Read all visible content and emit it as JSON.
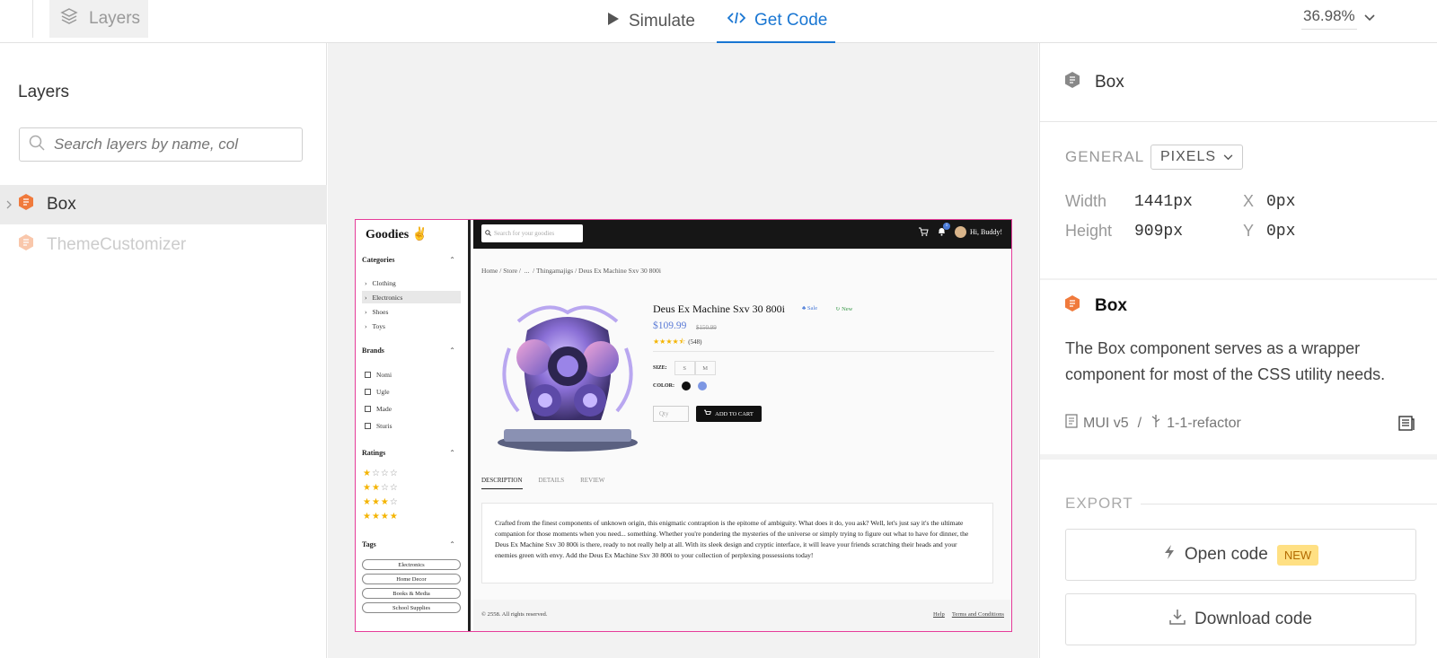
{
  "topbar": {
    "layers_label": "Layers",
    "simulate_label": "Simulate",
    "get_code_label": "Get Code",
    "zoom": "36.98%"
  },
  "left_panel": {
    "title": "Layers",
    "search_placeholder": "Search layers by name, col",
    "layers": [
      {
        "label": "Box",
        "selected": true
      },
      {
        "label": "ThemeCustomizer",
        "selected": false
      }
    ]
  },
  "preview": {
    "logo": "Goodies ✌",
    "sidebar": {
      "categories_heading": "Categories",
      "categories": [
        "Clothing",
        "Electronics",
        "Shoes",
        "Toys"
      ],
      "brands_heading": "Brands",
      "brands": [
        "Nomi",
        "Ugle",
        "Made",
        "Sturis"
      ],
      "ratings_heading": "Ratings",
      "tags_heading": "Tags",
      "tags": [
        "Electronics",
        "Home Decor",
        "Books & Media",
        "School Supplies"
      ]
    },
    "header": {
      "search_placeholder": "Search for your goodies",
      "badge": "1",
      "greeting": "Hi, Buddy!"
    },
    "breadcrumb": [
      "Home",
      "Store",
      "...",
      "Thingamajigs",
      "Deus Ex Machine Sxv 30 800i"
    ],
    "product": {
      "title": "Deus Ex Machine Sxv 30 800i",
      "sale_label": "Sale",
      "new_label": "New",
      "price": "$109.99",
      "old_price": "$150.99",
      "rating": 4.5,
      "reviews": "(548)",
      "size_label": "SIZE:",
      "sizes": [
        "S",
        "M"
      ],
      "color_label": "COLOR:",
      "colors": [
        "#111111",
        "#7d97e3"
      ],
      "qty_placeholder": "Qty",
      "add_to_cart": "ADD TO CART"
    },
    "tabs": [
      "DESCRIPTION",
      "DETAILS",
      "REVIEW"
    ],
    "description": "Crafted from the finest components of unknown origin, this enigmatic contraption is the epitome of ambiguity. What does it do, you ask? Well, let's just say it's the ultimate companion for those moments when you need... something. Whether you're pondering the mysteries of the universe or simply trying to figure out what to have for dinner, the Deus Ex Machine Sxv 30 800i is there, ready to not really help at all. With its sleek design and cryptic interface, it will leave your friends scratching their heads and your enemies green with envy. Add the Deus Ex Machine Sxv 30 800i to your collection of perplexing possessions today!",
    "footer": {
      "copyright": "© 2558. All rights reserved.",
      "help": "Help",
      "terms": "Terms and Conditions"
    }
  },
  "right_panel": {
    "header_title": "Box",
    "general_label": "GENERAL",
    "unit_select": "PIXELS",
    "width_label": "Width",
    "width_value": "1441px",
    "height_label": "Height",
    "height_value": "909px",
    "x_label": "X",
    "x_value": "0px",
    "y_label": "Y",
    "y_value": "0px",
    "component_name": "Box",
    "component_description": "The Box component serves as a wrapper component for most of the CSS utility needs.",
    "library": "MUI v5",
    "branch": "1-1-refactor",
    "export_label": "EXPORT",
    "open_code_label": "Open code",
    "new_badge": "NEW",
    "download_code_label": "Download code"
  },
  "colors": {
    "accent": "#1976d2",
    "component_orange": "#f07a3c",
    "selection_pink": "#e63c9a"
  }
}
